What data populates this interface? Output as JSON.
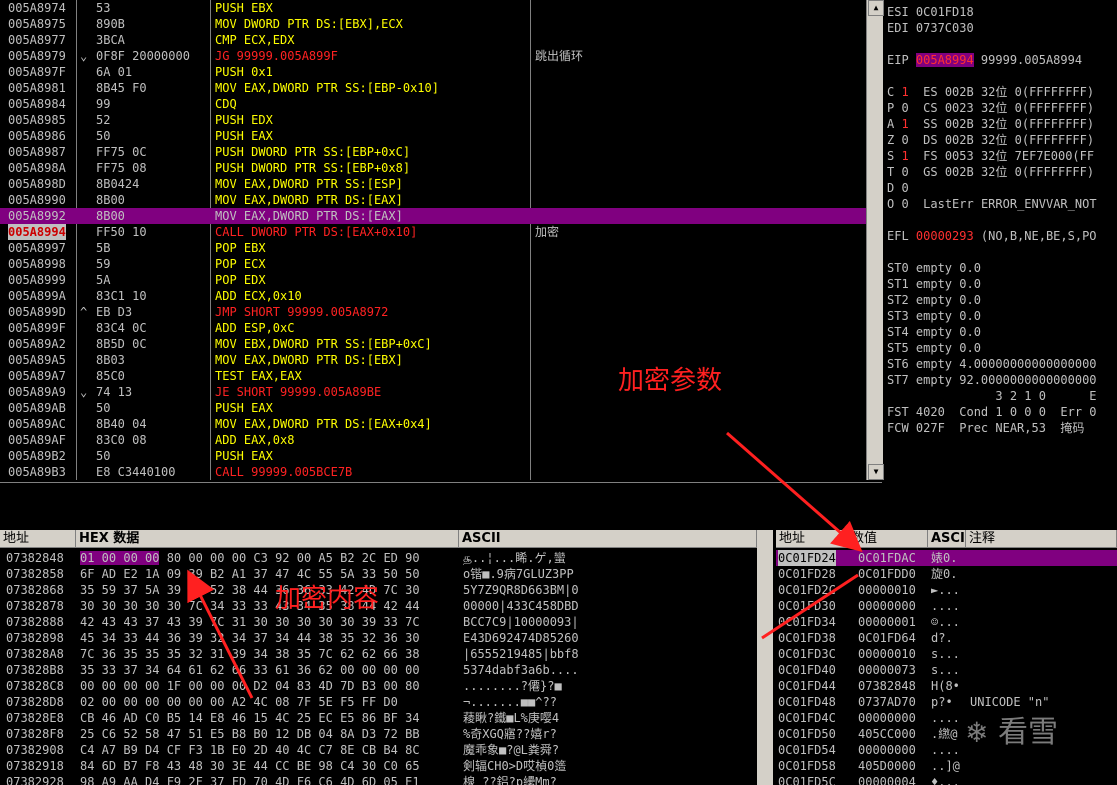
{
  "disasm": {
    "rows": [
      {
        "addr": "005A8974",
        "jmp": "",
        "hex": "53",
        "op": "PUSH EBX",
        "cls": "op-push",
        "cmt": ""
      },
      {
        "addr": "005A8975",
        "jmp": "",
        "hex": "890B",
        "op": "MOV DWORD PTR DS:[EBX],ECX",
        "cls": "op-mov",
        "cmt": ""
      },
      {
        "addr": "005A8977",
        "jmp": "",
        "hex": "3BCA",
        "op": "CMP ECX,EDX",
        "cls": "op-cmp",
        "cmt": ""
      },
      {
        "addr": "005A8979",
        "jmp": "⌄",
        "hex": "0F8F 20000000",
        "op": "JG 99999.005A899F",
        "cls": "op-jcc",
        "cmt": "跳出循环"
      },
      {
        "addr": "005A897F",
        "jmp": "",
        "hex": "6A 01",
        "op": "PUSH 0x1",
        "cls": "op-push",
        "cmt": ""
      },
      {
        "addr": "005A8981",
        "jmp": "",
        "hex": "8B45 F0",
        "op": "MOV EAX,DWORD PTR SS:[EBP-0x10]",
        "cls": "op-mov",
        "cmt": ""
      },
      {
        "addr": "005A8984",
        "jmp": "",
        "hex": "99",
        "op": "CDQ",
        "cls": "op-cdq",
        "cmt": ""
      },
      {
        "addr": "005A8985",
        "jmp": "",
        "hex": "52",
        "op": "PUSH EDX",
        "cls": "op-push",
        "cmt": ""
      },
      {
        "addr": "005A8986",
        "jmp": "",
        "hex": "50",
        "op": "PUSH EAX",
        "cls": "op-push",
        "cmt": ""
      },
      {
        "addr": "005A8987",
        "jmp": "",
        "hex": "FF75 0C",
        "op": "PUSH DWORD PTR SS:[EBP+0xC]",
        "cls": "op-push",
        "cmt": ""
      },
      {
        "addr": "005A898A",
        "jmp": "",
        "hex": "FF75 08",
        "op": "PUSH DWORD PTR SS:[EBP+0x8]",
        "cls": "op-push",
        "cmt": ""
      },
      {
        "addr": "005A898D",
        "jmp": "",
        "hex": "8B0424",
        "op": "MOV EAX,DWORD PTR SS:[ESP]",
        "cls": "op-mov",
        "cmt": ""
      },
      {
        "addr": "005A8990",
        "jmp": "",
        "hex": "8B00",
        "op": "MOV EAX,DWORD PTR DS:[EAX]",
        "cls": "op-mov",
        "cmt": ""
      },
      {
        "addr": "005A8992",
        "jmp": "",
        "hex": "8B00",
        "op": "MOV EAX,DWORD PTR DS:[EAX]",
        "cls": "op-mov",
        "cmt": "",
        "sel": true
      },
      {
        "addr": "005A8994",
        "jmp": "",
        "hex": "FF50 10",
        "op": "CALL DWORD PTR DS:[EAX+0x10]",
        "cls": "op-call",
        "cmt": "加密",
        "cur": true
      },
      {
        "addr": "005A8997",
        "jmp": "",
        "hex": "5B",
        "op": "POP EBX",
        "cls": "op-pop",
        "cmt": ""
      },
      {
        "addr": "005A8998",
        "jmp": "",
        "hex": "59",
        "op": "POP ECX",
        "cls": "op-pop",
        "cmt": ""
      },
      {
        "addr": "005A8999",
        "jmp": "",
        "hex": "5A",
        "op": "POP EDX",
        "cls": "op-pop",
        "cmt": ""
      },
      {
        "addr": "005A899A",
        "jmp": "",
        "hex": "83C1 10",
        "op": "ADD ECX,0x10",
        "cls": "op-add",
        "cmt": ""
      },
      {
        "addr": "005A899D",
        "jmp": "^",
        "hex": "EB D3",
        "op": "JMP SHORT 99999.005A8972",
        "cls": "op-jcc",
        "cmt": ""
      },
      {
        "addr": "005A899F",
        "jmp": "",
        "hex": "83C4 0C",
        "op": "ADD ESP,0xC",
        "cls": "op-add",
        "cmt": ""
      },
      {
        "addr": "005A89A2",
        "jmp": "",
        "hex": "8B5D 0C",
        "op": "MOV EBX,DWORD PTR SS:[EBP+0xC]",
        "cls": "op-mov",
        "cmt": ""
      },
      {
        "addr": "005A89A5",
        "jmp": "",
        "hex": "8B03",
        "op": "MOV EAX,DWORD PTR DS:[EBX]",
        "cls": "op-mov",
        "cmt": ""
      },
      {
        "addr": "005A89A7",
        "jmp": "",
        "hex": "85C0",
        "op": "TEST EAX,EAX",
        "cls": "op-test",
        "cmt": ""
      },
      {
        "addr": "005A89A9",
        "jmp": "⌄",
        "hex": "74 13",
        "op": "JE SHORT 99999.005A89BE",
        "cls": "op-jcc",
        "cmt": ""
      },
      {
        "addr": "005A89AB",
        "jmp": "",
        "hex": "50",
        "op": "PUSH EAX",
        "cls": "op-push",
        "cmt": ""
      },
      {
        "addr": "005A89AC",
        "jmp": "",
        "hex": "8B40 04",
        "op": "MOV EAX,DWORD PTR DS:[EAX+0x4]",
        "cls": "op-mov",
        "cmt": ""
      },
      {
        "addr": "005A89AF",
        "jmp": "",
        "hex": "83C0 08",
        "op": "ADD EAX,0x8",
        "cls": "op-add",
        "cmt": ""
      },
      {
        "addr": "005A89B2",
        "jmp": "",
        "hex": "50",
        "op": "PUSH EAX",
        "cls": "op-push",
        "cmt": ""
      },
      {
        "addr": "005A89B3",
        "jmp": "",
        "hex": "E8 C3440100",
        "op": "CALL 99999.005BCE7B",
        "cls": "op-call",
        "cmt": ""
      }
    ]
  },
  "registers": {
    "rows": [
      {
        "text": "ESI 0C01FD18"
      },
      {
        "text": "EDI 0737C030"
      },
      {
        "text": ""
      },
      {
        "name": "EIP ",
        "hl": "005A8994",
        "rest": " 99999.005A8994"
      },
      {
        "text": ""
      },
      {
        "flag": "C",
        "bit": "1",
        "rest": "  ES 002B 32位 0(FFFFFFFF)",
        "red": true
      },
      {
        "flag": "P",
        "bit": "0",
        "rest": "  CS 0023 32位 0(FFFFFFFF)"
      },
      {
        "flag": "A",
        "bit": "1",
        "rest": "  SS 002B 32位 0(FFFFFFFF)",
        "red": true
      },
      {
        "flag": "Z",
        "bit": "0",
        "rest": "  DS 002B 32位 0(FFFFFFFF)"
      },
      {
        "flag": "S",
        "bit": "1",
        "rest": "  FS 0053 32位 7EF7E000(FF",
        "red": true
      },
      {
        "flag": "T",
        "bit": "0",
        "rest": "  GS 002B 32位 0(FFFFFFFF)"
      },
      {
        "flag": "D",
        "bit": "0",
        "rest": ""
      },
      {
        "flag": "O",
        "bit": "0",
        "rest": "  LastErr ERROR_ENVVAR_NOT"
      },
      {
        "text": ""
      },
      {
        "name": "EFL ",
        "red": "00000293",
        "rest": " (NO,B,NE,BE,S,PO"
      },
      {
        "text": ""
      },
      {
        "text": "ST0 empty 0.0"
      },
      {
        "text": "ST1 empty 0.0"
      },
      {
        "text": "ST2 empty 0.0"
      },
      {
        "text": "ST3 empty 0.0"
      },
      {
        "text": "ST4 empty 0.0"
      },
      {
        "text": "ST5 empty 0.0"
      },
      {
        "text": "ST6 empty 4.00000000000000000"
      },
      {
        "text": "ST7 empty 92.0000000000000000"
      },
      {
        "text": "               3 2 1 0      E"
      },
      {
        "text": "FST 4020  Cond 1 0 0 0  Err 0"
      },
      {
        "text": "FCW 027F  Prec NEAR,53  掩码"
      }
    ]
  },
  "dump": {
    "headers": {
      "addr": "地址",
      "hex": "HEX 数据",
      "ascii": "ASCII"
    },
    "rows": [
      {
        "addr": "07382848",
        "hexsel": "01 00 00 00",
        "hex": " 80 00 00 00 C3 92 00 A5 B2 2C ED 90",
        "ascii": "௲..¦...睎.ゲ,蠻"
      },
      {
        "addr": "07382858",
        "hex": "6F AD E2 1A 09 39 B2 A1 37 47 4C 55 5A 33 50 50",
        "ascii": "o锴■.9病7GLUZ3PP"
      },
      {
        "addr": "07382868",
        "hex": "35 59 37 5A 39 51 52 38 44 36 36 33 42 4D 7C 30",
        "ascii": "5Y7Z9QR8D663BM|0"
      },
      {
        "addr": "07382878",
        "hex": "30 30 30 30 30 7C 34 33 33 43 34 35 38 44 42 44",
        "ascii": "00000|433C458DBD"
      },
      {
        "addr": "07382888",
        "hex": "42 43 43 37 43 39 7C 31 30 30 30 30 30 39 33 7C",
        "ascii": "BCC7C9|10000093|"
      },
      {
        "addr": "07382898",
        "hex": "45 34 33 44 36 39 32 34 37 34 44 38 35 32 36 30",
        "ascii": "E43D692474D85260"
      },
      {
        "addr": "073828A8",
        "hex": "7C 36 35 35 35 32 31 39 34 38 35 7C 62 62 66 38",
        "ascii": "|6555219485|bbf8"
      },
      {
        "addr": "073828B8",
        "hex": "35 33 37 34 64 61 62 66 33 61 36 62 00 00 00 00",
        "ascii": "5374dabf3a6b...."
      },
      {
        "addr": "073828C8",
        "hex": "00 00 00 00 1F 00 00 00 D2 04 83 4D 7D B3 00 80",
        "ascii": "........?僊}?■"
      },
      {
        "addr": "073828D8",
        "hex": "02 00 00 00 00 00 00 A2 4C 08 7F 5E F5 FF D0",
        "ascii": "¬.......■■^??"
      },
      {
        "addr": "073828E8",
        "hex": "CB 46 AD C0 B5 14 E8 46 15 4C 25 EC E5 86 BF 34",
        "ascii": "薐瞅?鐵■L%庚嘤4"
      },
      {
        "addr": "073828F8",
        "hex": "25 C6 52 58 47 51 E5 B8 B0 12 DB 04 8A D3 72 BB",
        "ascii": "%奇XGQ寤??嬉r?"
      },
      {
        "addr": "07382908",
        "hex": "C4 A7 B9 D4 CF F3 1B E0 2D 40 4C C7 8E CB B4 8C",
        "ascii": "魔乖象■?@L粪舜?"
      },
      {
        "addr": "07382918",
        "hex": "84 6D B7 F8 43 48 30 3E 44 CC BE 98 C4 30 C0 65",
        "ascii": "剣辐CH0>D哎楨0簉"
      },
      {
        "addr": "07382928",
        "hex": "98 A9 AA D4 F9 2F 37 FD 70 4D F6 C6 4D 6D 05 E1",
        "ascii": "楾 ??鋁?p纝Mm?"
      }
    ]
  },
  "stack": {
    "headers": {
      "addr": "地址",
      "val": "数值",
      "ascii": "ASCI",
      "cmt": "注释"
    },
    "rows": [
      {
        "addr": "0C01FD24",
        "val": "0C01FDAC",
        "asc": "婊0.",
        "cmt": "",
        "sel": true
      },
      {
        "addr": "0C01FD28",
        "val": "0C01FDD0",
        "asc": "旋0.",
        "cmt": ""
      },
      {
        "addr": "0C01FD2C",
        "val": "00000010",
        "asc": "►...",
        "cmt": ""
      },
      {
        "addr": "0C01FD30",
        "val": "00000000",
        "asc": "....",
        "cmt": ""
      },
      {
        "addr": "0C01FD34",
        "val": "00000001",
        "asc": "☺...",
        "cmt": ""
      },
      {
        "addr": "0C01FD38",
        "val": "0C01FD64",
        "asc": "d?.",
        "cmt": ""
      },
      {
        "addr": "0C01FD3C",
        "val": "00000010",
        "asc": "s...",
        "cmt": ""
      },
      {
        "addr": "0C01FD40",
        "val": "00000073",
        "asc": "s...",
        "cmt": ""
      },
      {
        "addr": "0C01FD44",
        "val": "07382848",
        "asc": "H(8•",
        "cmt": ""
      },
      {
        "addr": "0C01FD48",
        "val": "0737AD70",
        "asc": "p?•",
        "cmt": "UNICODE \"n\""
      },
      {
        "addr": "0C01FD4C",
        "val": "00000000",
        "asc": "....",
        "cmt": ""
      },
      {
        "addr": "0C01FD50",
        "val": "405CC000",
        "asc": ".繺@",
        "cmt": ""
      },
      {
        "addr": "0C01FD54",
        "val": "00000000",
        "asc": "....",
        "cmt": ""
      },
      {
        "addr": "0C01FD58",
        "val": "405D0000",
        "asc": "..]@",
        "cmt": ""
      },
      {
        "addr": "0C01FD5C",
        "val": "00000004",
        "asc": "♦...",
        "cmt": ""
      }
    ]
  },
  "annotations": {
    "params": "加密参数",
    "content": "加密内容"
  },
  "watermark": "看雪",
  "colors": {
    "selection": "#800080",
    "annotation": "#ff2020"
  }
}
